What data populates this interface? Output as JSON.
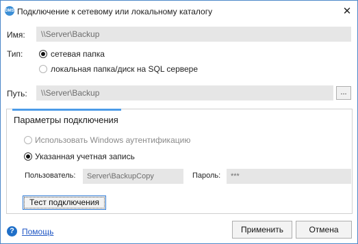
{
  "window": {
    "title": "Подключение к сетевому или локальному каталогу",
    "app_icon_text": "DMS",
    "close_glyph": "✕"
  },
  "name_field": {
    "label": "Имя:",
    "value": "\\\\Server\\Backup"
  },
  "type": {
    "label": "Тип:",
    "options": [
      {
        "label": "сетевая папка",
        "selected": true
      },
      {
        "label": "локальная папка/диск на SQL сервере",
        "selected": false
      }
    ]
  },
  "path_field": {
    "label": "Путь:",
    "value": "\\\\Server\\Backup",
    "browse_label": "..."
  },
  "connection": {
    "title": "Параметры подключения",
    "auth_options": [
      {
        "label": "Использовать Windows аутентификацию",
        "selected": false
      },
      {
        "label": "Указанная учетная запись",
        "selected": true
      }
    ],
    "user_label": "Пользователь:",
    "user_value": "Server\\BackupCopy",
    "password_label": "Пароль:",
    "password_value": "***",
    "test_button_label": "Тест подключения"
  },
  "footer": {
    "help_icon": "?",
    "help_label": "Помощь",
    "apply_label": "Применить",
    "cancel_label": "Отмена"
  },
  "colors": {
    "accent": "#4c9be8",
    "window_border": "#4a86c8",
    "field_bg": "#e6e6e6",
    "link": "#1f56c4"
  }
}
